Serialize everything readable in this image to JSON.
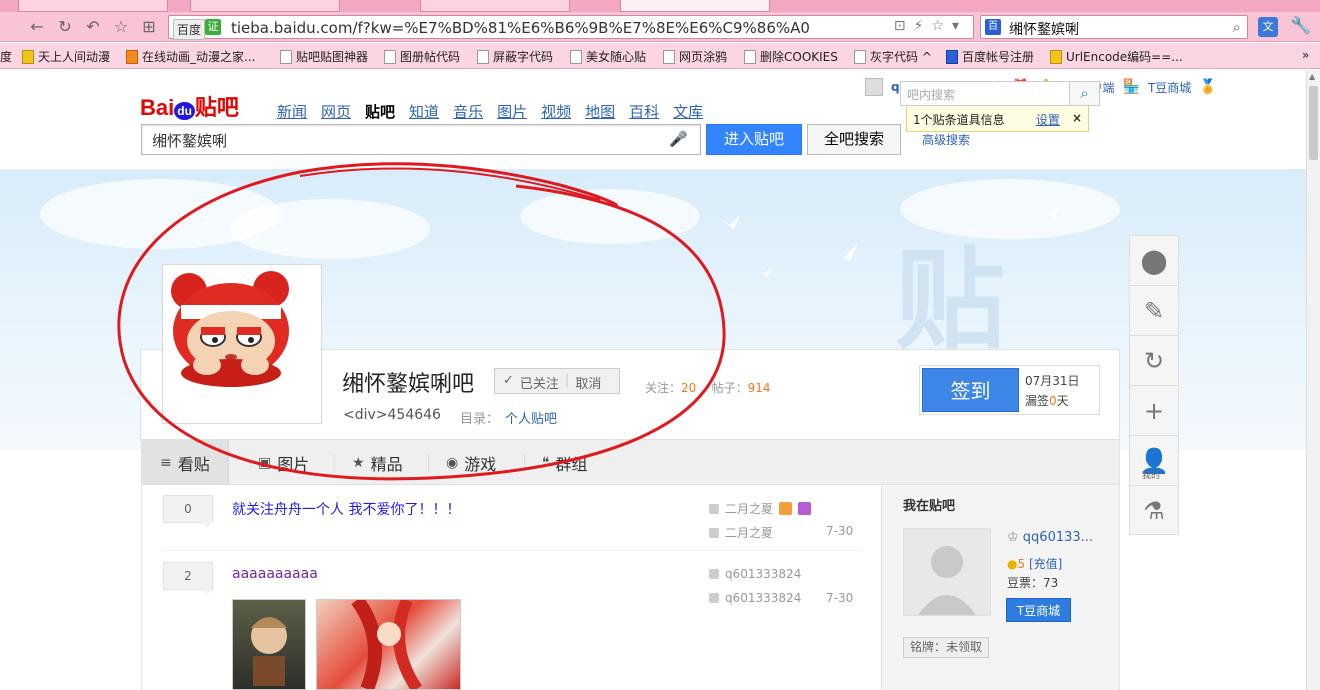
{
  "browser": {
    "tabs": [
      "",
      "",
      "",
      ""
    ],
    "url_engine": "百度",
    "url_ssl": "证",
    "url": "tieba.baidu.com/f?kw=%E7%BD%81%E6%B6%9B%E7%8E%E6%C9%86%A0",
    "search_engine": "百",
    "search_text": "缃怀鐜嫔唎",
    "translate": "文",
    "bookmarks": [
      {
        "label": "天上人间动漫",
        "icon": "yel"
      },
      {
        "label": "在线动画_动漫之家...",
        "icon": "org"
      },
      {
        "label": "贴吧贴图神器",
        "icon": ""
      },
      {
        "label": "图册帖代码",
        "icon": ""
      },
      {
        "label": "屏蔽字代码",
        "icon": ""
      },
      {
        "label": "美女随心贴",
        "icon": ""
      },
      {
        "label": "网页涂鸦",
        "icon": ""
      },
      {
        "label": "删除COOKIES",
        "icon": ""
      },
      {
        "label": "灰字代码 ^",
        "icon": ""
      },
      {
        "label": "百度帐号注册",
        "icon": "blue"
      },
      {
        "label": "UrlEncode编码==...",
        "icon": "yel"
      }
    ],
    "bookmark_leading": "度",
    "more": "»"
  },
  "header": {
    "logo_bai": "Bai",
    "logo_du": "du",
    "logo_tieba": "贴吧",
    "nav": [
      "新闻",
      "网页",
      "贴吧",
      "知道",
      "音乐",
      "图片",
      "视频",
      "地图",
      "百科",
      "文库"
    ],
    "current_nav": "贴吧",
    "search_value": "缃怀鐜嫔唎",
    "enter_button": "进入贴吧",
    "all_search_button": "全吧搜索",
    "advanced_search": "高级搜索",
    "username": "qq601333824",
    "client": "客户端",
    "tmall": "T豆商城",
    "tip_text": "1个贴条道具信息",
    "tip_settings": "设置",
    "tip_close": "×"
  },
  "forum": {
    "name": "缃怀鐜嫔唎吧",
    "followed": "已关注",
    "unfollow": "取消",
    "follow_label": "关注：",
    "follow_count": "20",
    "posts_label": "帖子：",
    "posts_count": "914",
    "div_text": "<div>454646",
    "dir_label": "目录：",
    "dir_link": "个人贴吧",
    "sign_button": "签到",
    "sign_date": "07月31日",
    "miss_prefix": "漏签",
    "miss_count": "0",
    "miss_suffix": "天",
    "banner_char": "贴"
  },
  "tabs": [
    {
      "label": "看贴",
      "icon": "≡"
    },
    {
      "label": "图片",
      "icon": "▣"
    },
    {
      "label": "精品",
      "icon": "★"
    },
    {
      "label": "游戏",
      "icon": "◉"
    },
    {
      "label": "群组",
      "icon": "❝"
    }
  ],
  "inforum_search_placeholder": "吧内搜索",
  "threads": [
    {
      "replies": "0",
      "title": "就关注舟舟一个人 我不爱你了！！！",
      "author": "二月之夏",
      "last_reply": "二月之夏",
      "date": "7-30"
    },
    {
      "replies": "2",
      "title": "aaaaaaaaaa",
      "author": "q601333824",
      "last_reply": "q601333824",
      "date": "7-30"
    }
  ],
  "side": {
    "title": "我在贴吧",
    "user": "qq60133...",
    "points": "5",
    "recharge": "[充值]",
    "beans": "豆票：73",
    "tmall_button": "T豆商城",
    "badge": "铭牌：未领取"
  },
  "float_bar": {
    "items": [
      "map-pin-icon",
      "edit-icon",
      "refresh-icon",
      "plus-icon",
      "user-icon",
      "flask-icon"
    ],
    "user_label": "我的"
  },
  "colors": {
    "accent": "#3385ff",
    "annotation": "#e0191e",
    "orange": "#f7781a"
  }
}
